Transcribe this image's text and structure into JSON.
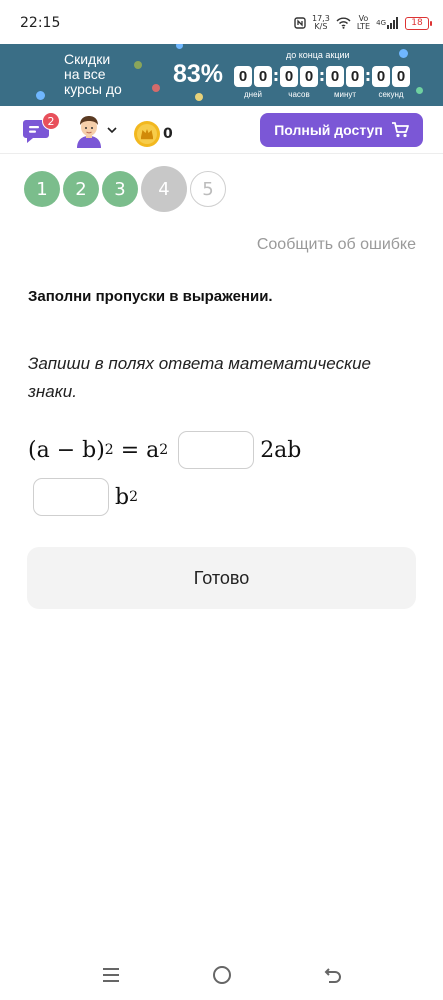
{
  "status_bar": {
    "time": "22:15",
    "speed_value": "17,3",
    "speed_unit": "K/S",
    "network_1": "Vo",
    "network_2": "LTE",
    "network_3": "4G",
    "battery": "18"
  },
  "promo": {
    "text_line1": "Скидки",
    "text_line2": "на все",
    "text_line3": "курсы до",
    "percent": "83%",
    "until_label": "до конца акции",
    "timer": [
      {
        "digits": [
          "0",
          "0"
        ],
        "label": "дней"
      },
      {
        "digits": [
          "0",
          "0"
        ],
        "label": "часов"
      },
      {
        "digits": [
          "0",
          "0"
        ],
        "label": "минут"
      },
      {
        "digits": [
          "0",
          "0"
        ],
        "label": "секунд"
      }
    ],
    "background_color": "#3a6e86"
  },
  "header": {
    "chat_badge": "2",
    "coins": "0",
    "full_access_label": "Полный доступ",
    "accent_color": "#7b57d6"
  },
  "steps": [
    {
      "label": "1",
      "state": "done"
    },
    {
      "label": "2",
      "state": "done"
    },
    {
      "label": "3",
      "state": "done"
    },
    {
      "label": "4",
      "state": "current"
    },
    {
      "label": "5",
      "state": "todo"
    }
  ],
  "task": {
    "report_link": "Сообщить об ошибке",
    "title": "Заполни пропуски в выражении.",
    "instruction": "Запиши в полях ответа математические знаки.",
    "expr_part1": "(a − b)",
    "expr_exp1": "2",
    "expr_part2": " = a",
    "expr_exp2": "2",
    "expr_part3": "2ab",
    "expr_part4": "b",
    "expr_exp4": "2",
    "answer1_value": "",
    "answer2_value": "",
    "done_label": "Готово"
  }
}
